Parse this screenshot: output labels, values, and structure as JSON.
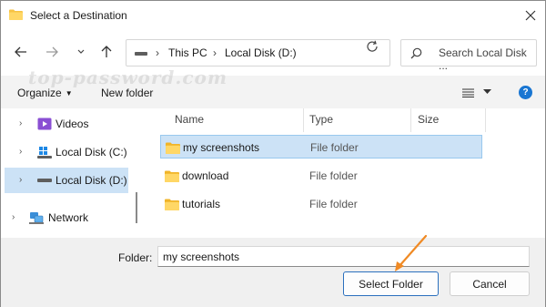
{
  "window": {
    "title": "Select a Destination"
  },
  "address": {
    "crumbs": [
      "This PC",
      "Local Disk (D:)"
    ]
  },
  "search": {
    "placeholder": "Search Local Disk ..."
  },
  "watermark": "top-password.com",
  "toolbar": {
    "organize_label": "Organize",
    "new_folder_label": "New folder"
  },
  "sidebar": {
    "items": [
      {
        "label": "Videos",
        "icon": "videos-icon",
        "selected": false
      },
      {
        "label": "Local Disk (C:)",
        "icon": "windows-drive-icon",
        "selected": false
      },
      {
        "label": "Local Disk (D:)",
        "icon": "drive-icon",
        "selected": true
      },
      {
        "label": "Network",
        "icon": "network-icon",
        "selected": false
      }
    ]
  },
  "files": {
    "columns": [
      "Name",
      "Type",
      "Size"
    ],
    "rows": [
      {
        "name": "my screenshots",
        "type": "File folder",
        "selected": true
      },
      {
        "name": "download",
        "type": "File folder",
        "selected": false
      },
      {
        "name": "tutorials",
        "type": "File folder",
        "selected": false
      }
    ]
  },
  "folder_field": {
    "label": "Folder:",
    "value": "my screenshots"
  },
  "buttons": {
    "select_folder": "Select Folder",
    "cancel": "Cancel"
  },
  "colors": {
    "selection": "#cce2f6",
    "accent": "#1976d2",
    "folder": "#f7c343",
    "arrow": "#f08a24"
  }
}
